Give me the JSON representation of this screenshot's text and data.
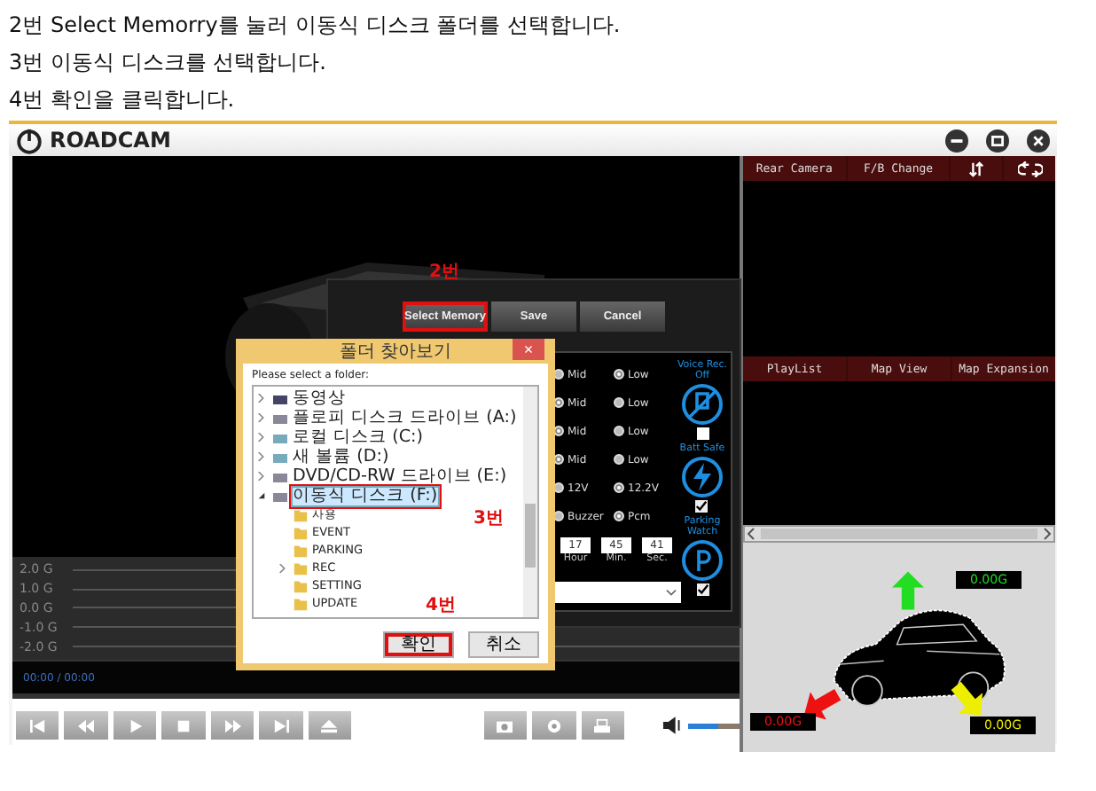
{
  "instructions": [
    "2번 Select Memorry를 눌러 이동식 디스크 폴더를 선택합니다.",
    "3번 이동식 디스크를 선택합니다.",
    "4번 확인을 클릭합니다."
  ],
  "app": {
    "title": "ROADCAM",
    "top_tabs": [
      {
        "kind": "text",
        "label": "Rear Camera"
      },
      {
        "kind": "text",
        "label": "F/B Change"
      },
      {
        "kind": "swap"
      },
      {
        "kind": "repeat"
      }
    ],
    "bottom_tabs": [
      "PlayList",
      "Map View",
      "Map Expansion"
    ],
    "graph_labels": [
      "2.0 G",
      "1.0 G",
      "0.0 G",
      "-1.0 G",
      "-2.0 G"
    ],
    "time": "00:00 / 00:00",
    "transport": [
      {
        "kind": "first"
      },
      {
        "kind": "rewind"
      },
      {
        "kind": "play"
      },
      {
        "kind": "stop"
      },
      {
        "kind": "forward"
      },
      {
        "kind": "last"
      },
      {
        "kind": "eject"
      }
    ],
    "tools": [
      {
        "kind": "camera"
      },
      {
        "kind": "gear"
      },
      {
        "kind": "print"
      }
    ],
    "volume": {
      "level": 0.6
    },
    "readings": [
      {
        "value": "0.00G",
        "color": "#22dd22",
        "kind": "up"
      },
      {
        "value": "0.00G",
        "color": "#ee1111",
        "kind": "left"
      },
      {
        "value": "0.00G",
        "color": "#eeee00",
        "kind": "right"
      }
    ]
  },
  "settings": {
    "buttons": [
      {
        "label": "Select Memory",
        "highlighted": true
      },
      {
        "label": "Save",
        "highlighted": false
      },
      {
        "label": "Cancel",
        "highlighted": false
      }
    ],
    "radio_rows": [
      [
        {
          "label": "Mid",
          "selected": false
        },
        {
          "label": "Low",
          "selected": true
        }
      ],
      [
        {
          "label": "Mid",
          "selected": true
        },
        {
          "label": "Low",
          "selected": false
        }
      ],
      [
        {
          "label": "Mid",
          "selected": true
        },
        {
          "label": "Low",
          "selected": false
        }
      ],
      [
        {
          "label": "Mid",
          "selected": true
        },
        {
          "label": "Low",
          "selected": false
        }
      ],
      [
        {
          "label": "12V",
          "selected": false
        },
        {
          "label": "12.2V",
          "selected": true
        }
      ],
      [
        {
          "label": "Buzzer",
          "selected": false
        },
        {
          "label": "Pcm",
          "selected": true
        }
      ]
    ],
    "time_fields": [
      {
        "value": "17",
        "label": "Hour"
      },
      {
        "value": "45",
        "label": "Min."
      },
      {
        "value": "41",
        "label": "Sec."
      }
    ],
    "side": [
      {
        "label": "Voice Rec. Off",
        "kind": "mic",
        "checked": false
      },
      {
        "label": "Batt Safe",
        "kind": "bolt",
        "checked": true
      },
      {
        "label": "Parking Watch",
        "kind": "p",
        "checked": true
      }
    ]
  },
  "folder_dialog": {
    "title": "폴더 찾아보기",
    "close": "×",
    "prompt": "Please select a folder:",
    "tree": [
      {
        "label": "동영상",
        "kind": "video",
        "expanded": false,
        "selected": false
      },
      {
        "label": "플로피 디스크 드라이브 (A:)",
        "kind": "floppy",
        "expanded": false,
        "selected": false
      },
      {
        "label": "로컬 디스크 (C:)",
        "kind": "disk",
        "expanded": false,
        "selected": false
      },
      {
        "label": "새 볼륨 (D:)",
        "kind": "disk",
        "expanded": false,
        "selected": false
      },
      {
        "label": "DVD/CD-RW 드라이브 (E:)",
        "kind": "dvd",
        "expanded": false,
        "selected": false
      },
      {
        "label": "이동식 디스크 (F:)",
        "kind": "drive",
        "expanded": true,
        "selected": true,
        "children": [
          {
            "label": "사용",
            "selected": false
          },
          {
            "label": "EVENT",
            "selected": false
          },
          {
            "label": "PARKING",
            "selected": false
          },
          {
            "label": "REC",
            "selected": false,
            "expanded": false
          },
          {
            "label": "SETTING",
            "selected": false
          },
          {
            "label": "UPDATE",
            "selected": false
          }
        ]
      }
    ],
    "buttons": [
      {
        "label": "확인",
        "highlighted": true
      },
      {
        "label": "취소",
        "highlighted": false
      }
    ]
  },
  "annotations": [
    "2번",
    "3번",
    "4번"
  ]
}
